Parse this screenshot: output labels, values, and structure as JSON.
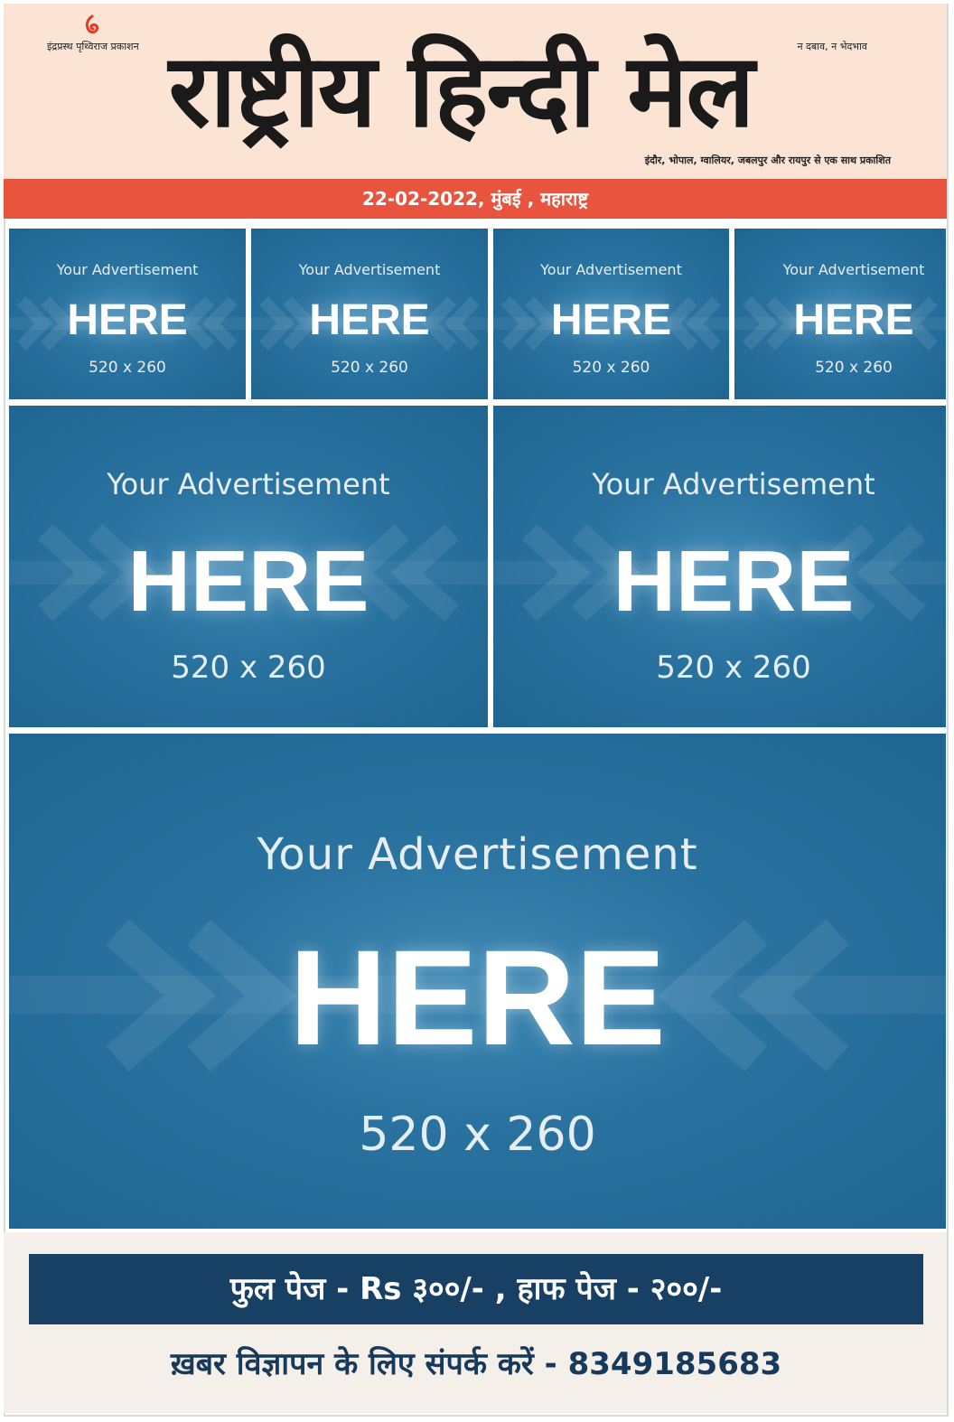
{
  "masthead": {
    "logo_icon": "flame-swirl-icon",
    "publisher": "इंद्रप्रस्थ पृथ्विराज प्रकाशन",
    "tagline": "न दबाव, न भेदभाव",
    "title": "राष्ट्रीय हिन्दी मेल",
    "editions": "इंदौर, भोपाल, ग्वालियर, जबलपुर और रायपुर से एक साथ प्रकाशित"
  },
  "dateline": "22-02-2022, मुंबई , महाराष्ट्र",
  "ads": [
    {
      "line1": "Your Advertisement",
      "line2": "HERE",
      "line3": "520 x 260"
    },
    {
      "line1": "Your Advertisement",
      "line2": "HERE",
      "line3": "520 x 260"
    },
    {
      "line1": "Your Advertisement",
      "line2": "HERE",
      "line3": "520 x 260"
    },
    {
      "line1": "Your Advertisement",
      "line2": "HERE",
      "line3": "520 x 260"
    },
    {
      "line1": "Your Advertisement",
      "line2": "HERE",
      "line3": "520 x 260"
    },
    {
      "line1": "Your Advertisement",
      "line2": "HERE",
      "line3": "520 x 260"
    },
    {
      "line1": "Your Advertisement",
      "line2": "HERE",
      "line3": "520 x 260"
    }
  ],
  "footer": {
    "rates": "फुल पेज - Rs ३००/- , हाफ पेज - २००/-",
    "contact": "ख़बर विज्ञापन के लिए संपर्क करें - 8349185683"
  },
  "colors": {
    "masthead_bg": "#fbe4d3",
    "dateline_bg": "#e9543f",
    "ad_blue": "#2a73a0",
    "rate_bar_bg": "#174064",
    "contact_text": "#173a5c"
  }
}
